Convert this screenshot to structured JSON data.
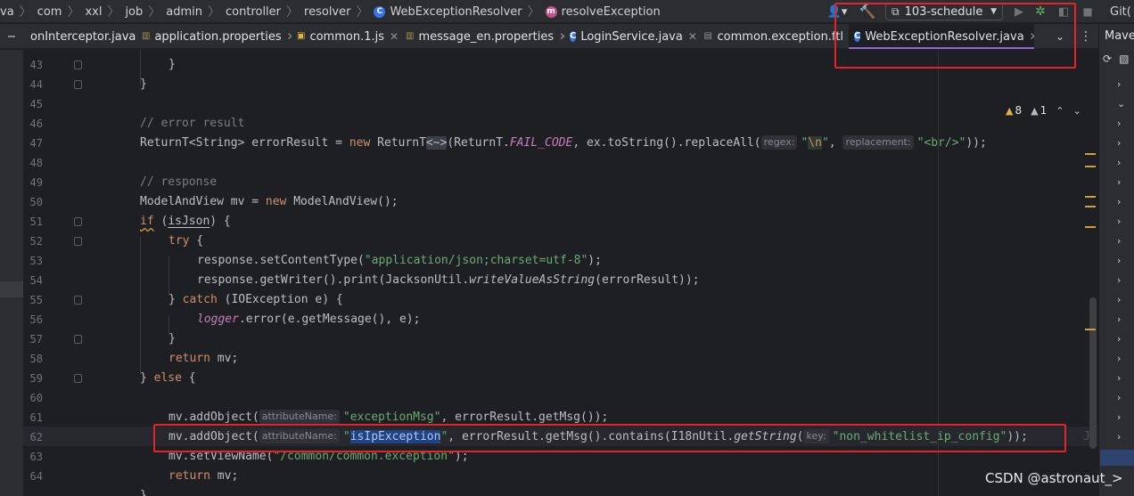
{
  "breadcrumb": [
    "va",
    "com",
    "xxl",
    "job",
    "admin",
    "controller",
    "resolver",
    "WebExceptionResolver",
    "resolveException"
  ],
  "toolbar": {
    "user_icon": "user-icon",
    "build_icon": "hammer-icon",
    "run_config": "103-schedule",
    "git_label": "Git("
  },
  "tabs": [
    {
      "label": "onInterceptor.java",
      "icon": "class",
      "width": 125
    },
    {
      "label": "application.properties",
      "icon": "props",
      "width": 174
    },
    {
      "label": "common.1.js",
      "icon": "js",
      "width": 122
    },
    {
      "label": "message_en.properties",
      "icon": "props",
      "width": 184
    },
    {
      "label": "LoginService.java",
      "icon": "class",
      "width": 150
    },
    {
      "label": "common.exception.ftl",
      "icon": "file",
      "width": 169
    }
  ],
  "active_tab": "WebExceptionResolver.java",
  "inspection": {
    "warnings": "8",
    "weak_warnings": "1"
  },
  "maven_label": "Maven",
  "code": {
    "lines": [
      "43",
      "44",
      "45",
      "46",
      "47",
      "48",
      "49",
      "50",
      "51",
      "52",
      "53",
      "54",
      "55",
      "56",
      "57",
      "58",
      "59",
      "60",
      "61",
      "62",
      "63",
      "64"
    ],
    "comment_error": "// error result",
    "line47": {
      "p1": "ReturnT<String> errorResult = ",
      "kw_new": "new",
      "p2": " ReturnT",
      "diamond": "<~>",
      "p3": "(ReturnT.",
      "fail_code": "FAIL_CODE",
      "p4": ", ex.toString().replaceAll(",
      "hint_regex": "regex:",
      "str_regex_open": "\"",
      "escape": "\\n",
      "str_regex_close": "\"",
      "p5": ", ",
      "hint_replacement": "replacement:",
      "str_replacement": "\"<br/>\"",
      "p6": "));"
    },
    "comment_response": "// response",
    "line50": {
      "p1": "ModelAndView mv = ",
      "kw_new": "new",
      "p2": " ModelAndView();"
    },
    "line51": {
      "kw_if": "if",
      "p1": " (",
      "var": "isJson",
      "p2": ") {"
    },
    "line52": {
      "kw_try": "try",
      "p1": " {"
    },
    "line53": {
      "p1": "response.setContentType(",
      "str": "\"application/json;charset=utf-8\"",
      "p2": ");"
    },
    "line54": {
      "p1": "response.getWriter().print(JacksonUtil.",
      "method": "writeValueAsString",
      "p2": "(errorResult));"
    },
    "line55": {
      "p1": "} ",
      "kw_catch": "catch",
      "p2": " (IOException e) {"
    },
    "line56": {
      "logger": "logger",
      "p1": ".error(e.getMessage(), e);"
    },
    "line57": "}",
    "line58": {
      "kw_return": "return",
      "p1": " mv;"
    },
    "line59": {
      "p1": "} ",
      "kw_else": "else",
      "p2": " {"
    },
    "line61": {
      "p1": "mv.addObject(",
      "hint": "attributeName:",
      "str": "\"exceptionMsg\"",
      "p2": ", errorResult.getMsg());"
    },
    "line62": {
      "p1": "mv.addObject(",
      "hint": "attributeName:",
      "q_open": "\"",
      "selected": "isIpException",
      "q_close": "\"",
      "p2": ", errorResult.getMsg().contains(I18nUtil.",
      "method": "getString",
      "p3": "(",
      "hint_key": "key:",
      "str_key": "\"non_whitelist_ip_config\"",
      "p4": "));"
    },
    "line63": {
      "p1": "mv.setViewName(",
      "str": "\"/common/common.exception\"",
      "p2": ");"
    },
    "line64": {
      "kw_return": "return",
      "p1": " mv;"
    },
    "line43_close": "}",
    "line44_close": "}",
    "line65_partial": "}",
    "ghost_hint": "Ji"
  },
  "watermark": "CSDN @astronaut_>"
}
